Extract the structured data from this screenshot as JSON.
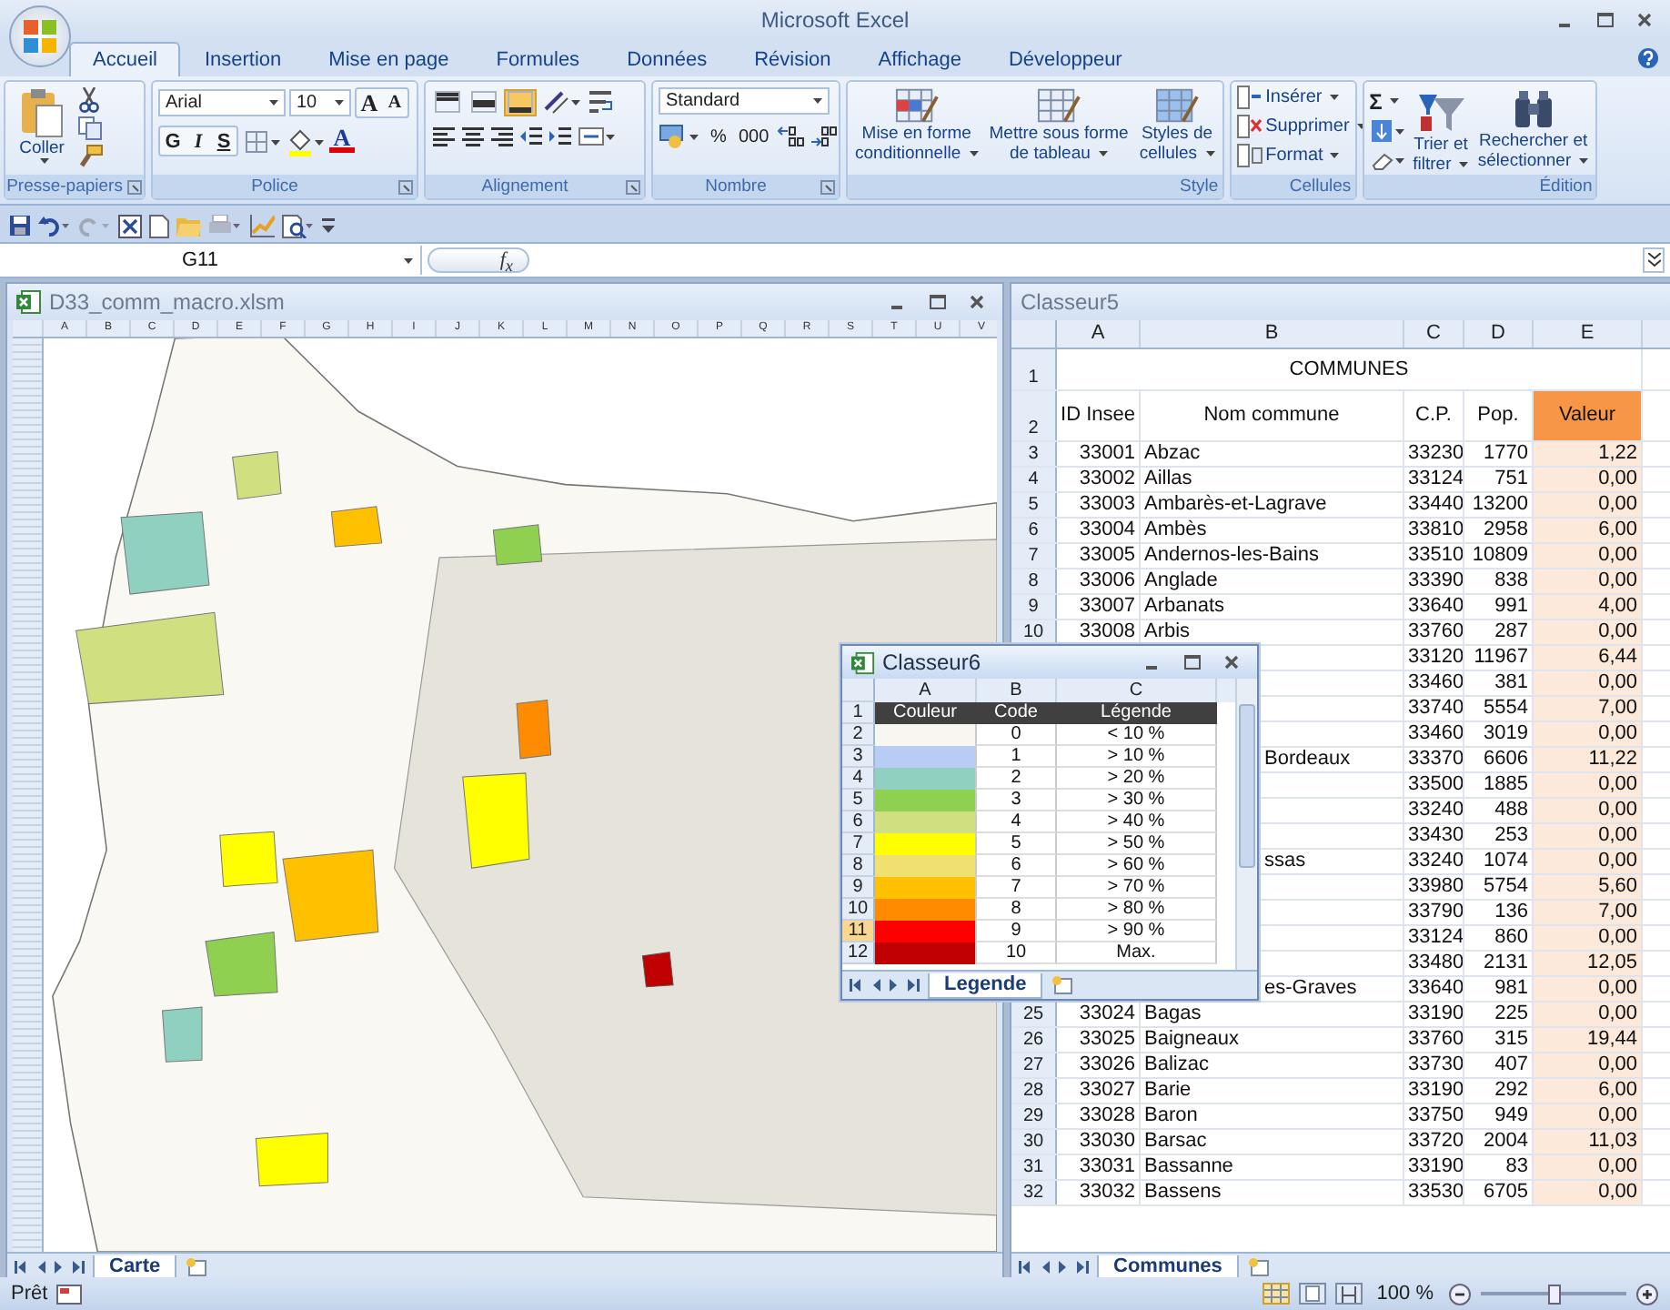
{
  "window": {
    "title": "Microsoft Excel"
  },
  "ribbon_tabs": [
    {
      "label": "Accueil",
      "selected": true
    },
    {
      "label": "Insertion",
      "selected": false
    },
    {
      "label": "Mise en page",
      "selected": false
    },
    {
      "label": "Formules",
      "selected": false
    },
    {
      "label": "Données",
      "selected": false
    },
    {
      "label": "Révision",
      "selected": false
    },
    {
      "label": "Affichage",
      "selected": false
    },
    {
      "label": "Développeur",
      "selected": false
    }
  ],
  "clipboard": {
    "paste": "Coller",
    "group": "Presse-papiers"
  },
  "font": {
    "name": "Arial",
    "size": "10",
    "grow": "A",
    "shrink": "A",
    "bold": "G",
    "italic": "I",
    "underline": "S",
    "font_color": "A",
    "group": "Police"
  },
  "alignment": {
    "vertical": [
      {
        "selected": false
      },
      {
        "selected": false
      },
      {
        "selected": true
      }
    ],
    "group": "Alignement"
  },
  "number": {
    "format": "Standard",
    "percent": "%",
    "thousands": "000",
    "group": "Nombre"
  },
  "style": {
    "buttons": [
      {
        "lines": [
          "Mise en forme",
          "conditionnelle"
        ]
      },
      {
        "lines": [
          "Mettre sous forme",
          "de tableau"
        ]
      },
      {
        "lines": [
          "Styles de",
          "cellules"
        ]
      }
    ],
    "group": "Style"
  },
  "cells": {
    "buttons": [
      "Insérer",
      "Supprimer",
      "Format"
    ],
    "group": "Cellules"
  },
  "editing": {
    "sum": "Σ",
    "buttons": [
      {
        "lines": [
          "Trier et",
          "filtrer"
        ]
      },
      {
        "lines": [
          "Rechercher et",
          "sélectionner"
        ]
      }
    ],
    "group": "Édition"
  },
  "formula_bar": {
    "name_box": "G11",
    "fx": "f$_{x}$"
  },
  "map_window": {
    "title": "D33_comm_macro.xlsm",
    "active": false,
    "columns": [
      "A",
      "B",
      "C",
      "D",
      "E",
      "F",
      "G",
      "H",
      "I",
      "J",
      "K",
      "L",
      "M",
      "N",
      "O",
      "P",
      "Q",
      "R",
      "S",
      "T",
      "U",
      "V"
    ],
    "sheet_tabs": [
      {
        "label": "Carte",
        "selected": true
      }
    ]
  },
  "data_window": {
    "title": "Classeur5",
    "active": false,
    "columns": [
      "A",
      "B",
      "C",
      "D",
      "E"
    ],
    "title_row": "COMMUNES",
    "headers": [
      "ID Insee",
      "Nom commune",
      "C.P.",
      "Pop.",
      "Valeur"
    ],
    "rows": [
      {
        "row": "1"
      },
      {
        "row": "2"
      },
      {
        "row": "3",
        "id": "33001",
        "name": "Abzac",
        "cp": "33230",
        "pop": "1770",
        "value": "1,22"
      },
      {
        "row": "4",
        "id": "33002",
        "name": "Aillas",
        "cp": "33124",
        "pop": "751",
        "value": "0,00"
      },
      {
        "row": "5",
        "id": "33003",
        "name": "Ambarès-et-Lagrave",
        "cp": "33440",
        "pop": "13200",
        "value": "0,00"
      },
      {
        "row": "6",
        "id": "33004",
        "name": "Ambès",
        "cp": "33810",
        "pop": "2958",
        "value": "6,00"
      },
      {
        "row": "7",
        "id": "33005",
        "name": "Andernos-les-Bains",
        "cp": "33510",
        "pop": "10809",
        "value": "0,00"
      },
      {
        "row": "8",
        "id": "33006",
        "name": "Anglade",
        "cp": "33390",
        "pop": "838",
        "value": "0,00"
      },
      {
        "row": "9",
        "id": "33007",
        "name": "Arbanats",
        "cp": "33640",
        "pop": "991",
        "value": "4,00"
      },
      {
        "row": "10",
        "id": "33008",
        "name": "Arbis",
        "cp": "33760",
        "pop": "287",
        "value": "0,00"
      },
      {
        "cp": "33120",
        "pop": "11967",
        "value": "6,44"
      },
      {
        "cp": "33460",
        "pop": "381",
        "value": "0,00"
      },
      {
        "cp": "33740",
        "pop": "5554",
        "value": "7,00"
      },
      {
        "cp": "33460",
        "pop": "3019",
        "value": "0,00"
      },
      {
        "name": "Bordeaux",
        "cp": "33370",
        "pop": "6606",
        "value": "11,22"
      },
      {
        "cp": "33500",
        "pop": "1885",
        "value": "0,00"
      },
      {
        "cp": "33240",
        "pop": "488",
        "value": "0,00"
      },
      {
        "cp": "33430",
        "pop": "253",
        "value": "0,00"
      },
      {
        "name": "ssas",
        "cp": "33240",
        "pop": "1074",
        "value": "0,00"
      },
      {
        "cp": "33980",
        "pop": "5754",
        "value": "5,60"
      },
      {
        "cp": "33790",
        "pop": "136",
        "value": "7,00"
      },
      {
        "cp": "33124",
        "pop": "860",
        "value": "0,00"
      },
      {
        "cp": "33480",
        "pop": "2131",
        "value": "12,05"
      },
      {
        "name": "es-Graves",
        "cp": "33640",
        "pop": "981",
        "value": "0,00"
      },
      {
        "row": "25",
        "id": "33024",
        "name": "Bagas",
        "cp": "33190",
        "pop": "225",
        "value": "0,00"
      },
      {
        "row": "26",
        "id": "33025",
        "name": "Baigneaux",
        "cp": "33760",
        "pop": "315",
        "value": "19,44"
      },
      {
        "row": "27",
        "id": "33026",
        "name": "Balizac",
        "cp": "33730",
        "pop": "407",
        "value": "0,00"
      },
      {
        "row": "28",
        "id": "33027",
        "name": "Barie",
        "cp": "33190",
        "pop": "292",
        "value": "6,00"
      },
      {
        "row": "29",
        "id": "33028",
        "name": "Baron",
        "cp": "33750",
        "pop": "949",
        "value": "0,00"
      },
      {
        "row": "30",
        "id": "33030",
        "name": "Barsac",
        "cp": "33720",
        "pop": "2004",
        "value": "11,03"
      },
      {
        "row": "31",
        "id": "33031",
        "name": "Bassanne",
        "cp": "33190",
        "pop": "83",
        "value": "0,00"
      },
      {
        "row": "32",
        "id": "33032",
        "name": "Bassens",
        "cp": "33530",
        "pop": "6705",
        "value": "0,00"
      }
    ],
    "sheet_tabs": [
      {
        "label": "Communes",
        "selected": true
      }
    ]
  },
  "legend_window": {
    "title": "Classeur6",
    "active": true,
    "columns": [
      "A",
      "B",
      "C"
    ],
    "header_row": "1",
    "headers": [
      "Couleur",
      "Code",
      "Légende"
    ],
    "rows": [
      {
        "row": "2",
        "color": "#f8f6f0",
        "code": "0",
        "label": "< 10 %",
        "selected": false
      },
      {
        "row": "3",
        "color": "#b8ccf4",
        "code": "1",
        "label": "> 10 %",
        "selected": false
      },
      {
        "row": "4",
        "color": "#90d0c0",
        "code": "2",
        "label": "> 20 %",
        "selected": false
      },
      {
        "row": "5",
        "color": "#90d050",
        "code": "3",
        "label": "> 30 %",
        "selected": false
      },
      {
        "row": "6",
        "color": "#d0e080",
        "code": "4",
        "label": "> 40 %",
        "selected": false
      },
      {
        "row": "7",
        "color": "#ffff00",
        "code": "5",
        "label": "> 50 %",
        "selected": false
      },
      {
        "row": "8",
        "color": "#f0e070",
        "code": "6",
        "label": "> 60 %",
        "selected": false
      },
      {
        "row": "9",
        "color": "#ffc000",
        "code": "7",
        "label": "> 70 %",
        "selected": false
      },
      {
        "row": "10",
        "color": "#ff8c00",
        "code": "8",
        "label": "> 80 %",
        "selected": false
      },
      {
        "row": "11",
        "color": "#ff0000",
        "code": "9",
        "label": "> 90 %",
        "selected": true
      },
      {
        "row": "12",
        "color": "#c00000",
        "code": "10",
        "label": "Max.",
        "selected": false
      }
    ],
    "sheet_tabs": [
      {
        "label": "Legende",
        "selected": true
      }
    ]
  },
  "status_bar": {
    "text": "Prêt",
    "zoom": "100 %",
    "zoom_slider": {
      "level": 0.5
    }
  }
}
